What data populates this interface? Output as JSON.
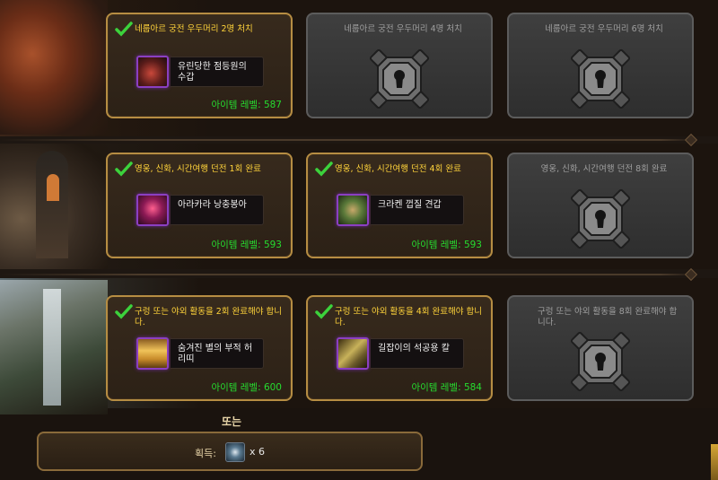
{
  "rows": [
    {
      "cards": [
        {
          "state": "done",
          "requirement": "네룹아르 궁전 우두머리 2명 처치",
          "item_name": "유린당한 점등원의 수갑",
          "item_icon": "gauntlet-icon",
          "item_level": "아이템 레벨: 587"
        },
        {
          "state": "locked",
          "requirement": "네룹아르 궁전 우두머리 4명 처치"
        },
        {
          "state": "locked",
          "requirement": "네룹아르 궁전 우두머리 6명 처치"
        }
      ]
    },
    {
      "cards": [
        {
          "state": "done",
          "requirement": "영웅, 신화, 시간여행 던전 1회 완료",
          "item_name": "아라카라 낭충봉아",
          "item_icon": "cloak-icon",
          "item_level": "아이템 레벨: 593"
        },
        {
          "state": "done",
          "requirement": "영웅, 신화, 시간여행 던전 4회 완료",
          "item_name": "크라켄 껍질 견갑",
          "item_icon": "shoulders-icon",
          "item_level": "아이템 레벨: 593"
        },
        {
          "state": "locked",
          "requirement": "영웅, 신화, 시간여행 던전 8회 완료"
        }
      ]
    },
    {
      "cards": [
        {
          "state": "done",
          "requirement": "구렁 또는 야외 활동을 2회 완료해야 합니다.",
          "item_name": "숨겨진 별의 부적 허리띠",
          "item_icon": "belt-icon",
          "item_level": "아이템 레벨: 600"
        },
        {
          "state": "done",
          "requirement": "구렁 또는 야외 활동을 4회 완료해야 합니다.",
          "item_name": "길잡이의 석공용 칼",
          "item_icon": "dagger-icon",
          "item_level": "아이템 레벨: 584"
        },
        {
          "state": "locked",
          "requirement": "구렁 또는 야외 활동을 8회 완료해야 합니다."
        }
      ]
    }
  ],
  "or_label": "또는",
  "currency": {
    "label": "획득:",
    "icon": "resonance-crystal-icon",
    "count": "x 6"
  },
  "colors": {
    "gold_text": "#ffd33a",
    "item_level_green": "#26dc2f",
    "epic_border": "#8b3fc2",
    "completed_border": "#b68d43",
    "locked_border": "#5c5c5c"
  }
}
